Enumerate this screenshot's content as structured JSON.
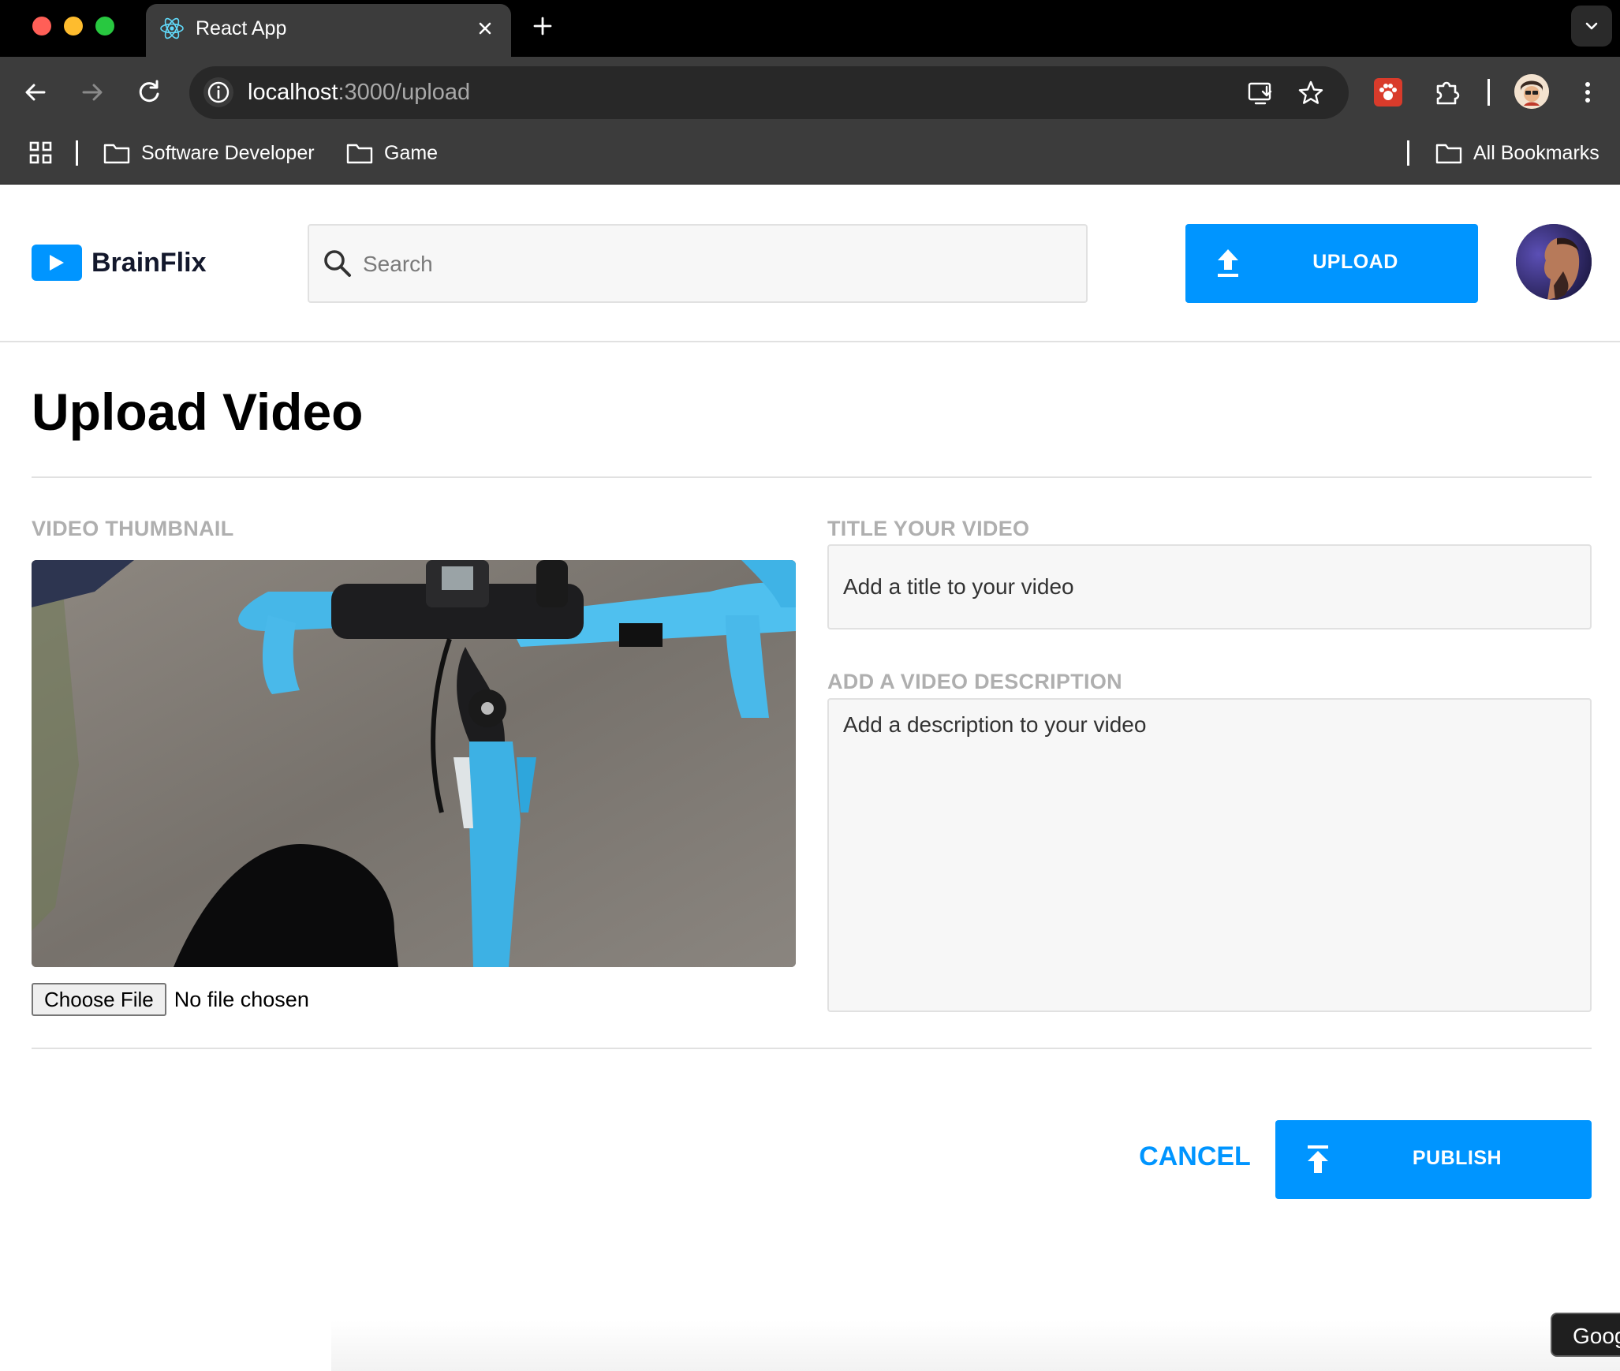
{
  "browser": {
    "tab_title": "React App",
    "url_host": "localhost",
    "url_path": ":3000/upload",
    "bookmarks": [
      "Software Developer",
      "Game"
    ],
    "all_bookmarks": "All Bookmarks",
    "icons": [
      "back-icon",
      "forward-icon",
      "reload-icon",
      "site-info-icon",
      "install-app-icon",
      "star-icon",
      "extension-icon",
      "puzzle-icon",
      "more-icon",
      "apps-icon",
      "folder-icon"
    ]
  },
  "header": {
    "logo_text": "BrainFlix",
    "search_placeholder": "Search",
    "upload_label": "UPLOAD"
  },
  "main": {
    "title": "Upload Video",
    "thumbnail_label": "VIDEO THUMBNAIL",
    "choose_file_label": "Choose File",
    "file_status": "No file chosen",
    "title_label": "TITLE YOUR VIDEO",
    "title_placeholder": "Add a title to your video",
    "description_label": "ADD A VIDEO DESCRIPTION",
    "description_placeholder": "Add a description to your video",
    "cancel_label": "CANCEL",
    "publish_label": "PUBLISH"
  },
  "overlay": {
    "google_chip": "Goog"
  },
  "colors": {
    "accent": "#0095ff",
    "heading": "#13182c",
    "label": "#afafaf",
    "border": "#e1e1e1",
    "field_bg": "#f7f7f7"
  }
}
